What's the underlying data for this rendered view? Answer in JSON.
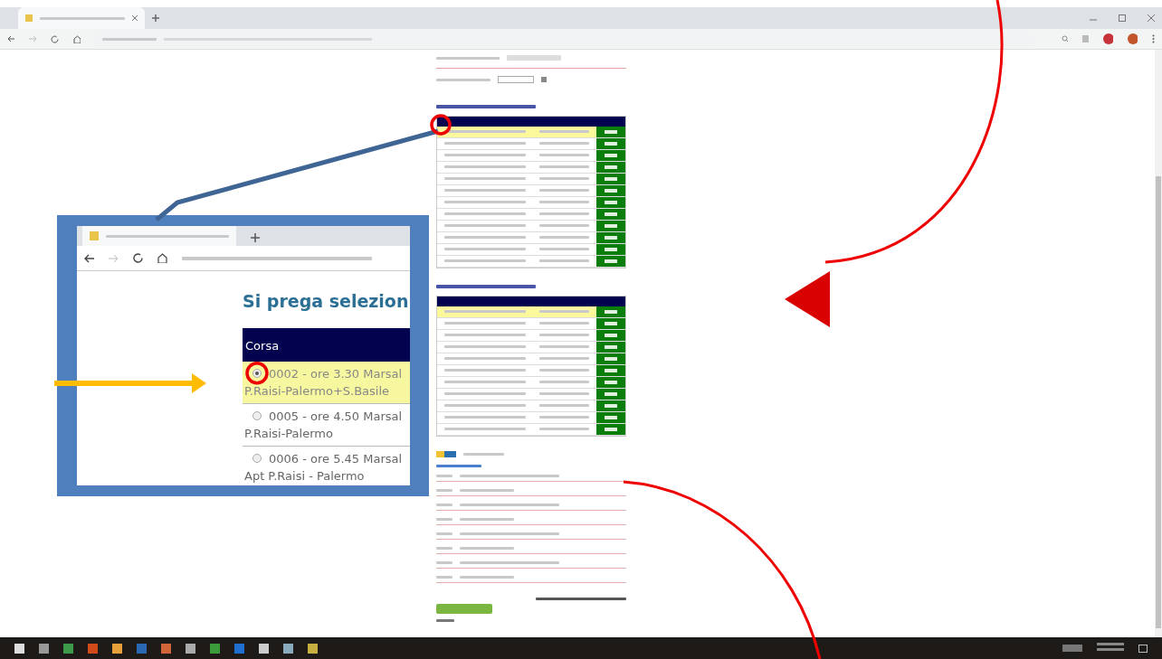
{
  "inset": {
    "heading": "Si prega selezion",
    "column": "Corsa",
    "rows": [
      {
        "line1": "0002 - ore 3.30 Marsal",
        "line2": "P.Raisi-Palermo+S.Basile",
        "selected": true
      },
      {
        "line1": "0005 - ore 4.50 Marsal",
        "line2": "P.Raisi-Palermo",
        "selected": false
      },
      {
        "line1": "0006 - ore 5.45 Marsal",
        "line2": "Apt P.Raisi - Palermo",
        "selected": false
      }
    ]
  },
  "tables": [
    {
      "rows": [
        {
          "selected": true
        },
        {
          "selected": false
        },
        {
          "selected": false
        },
        {
          "selected": false
        },
        {
          "selected": false
        },
        {
          "selected": false
        },
        {
          "selected": false
        },
        {
          "selected": false
        },
        {
          "selected": false
        },
        {
          "selected": false
        },
        {
          "selected": false
        },
        {
          "selected": false
        }
      ]
    },
    {
      "rows": [
        {
          "selected": true
        },
        {
          "selected": false
        },
        {
          "selected": false
        },
        {
          "selected": false
        },
        {
          "selected": false
        },
        {
          "selected": false
        },
        {
          "selected": false
        },
        {
          "selected": false
        },
        {
          "selected": false
        },
        {
          "selected": false
        },
        {
          "selected": false
        }
      ]
    }
  ]
}
